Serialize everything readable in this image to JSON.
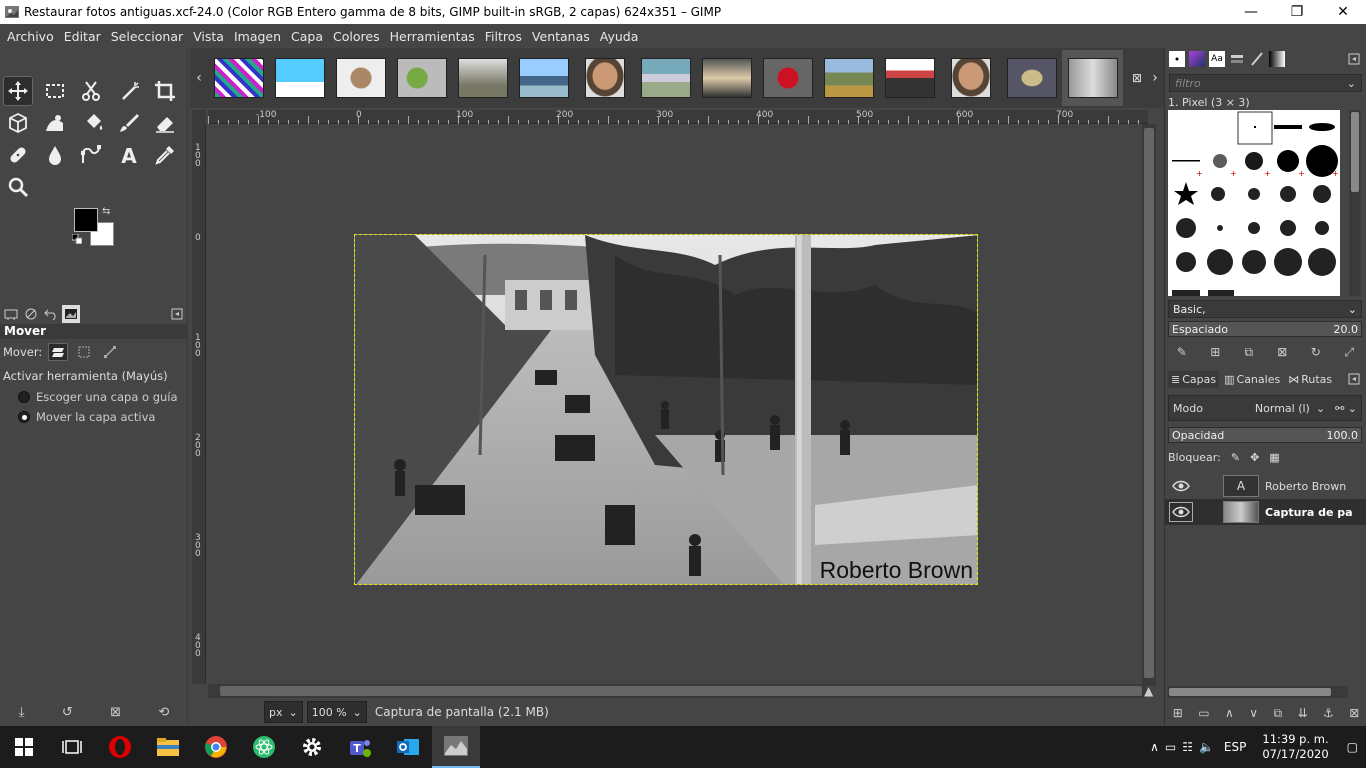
{
  "window": {
    "title": "Restaurar fotos antiguas.xcf-24.0 (Color RGB Entero gamma de 8 bits, GIMP built-in sRGB, 2 capas) 624x351 – GIMP",
    "minimize": "—",
    "maximize": "❐",
    "close": "✕"
  },
  "menu": [
    "Archivo",
    "Editar",
    "Seleccionar",
    "Vista",
    "Imagen",
    "Capa",
    "Colores",
    "Herramientas",
    "Filtros",
    "Ventanas",
    "Ayuda"
  ],
  "tool_options": {
    "title": "Mover",
    "mover_label": "Mover:",
    "activate_label": "Activar herramienta  (Mayús)",
    "option1": "Escoger una capa o guía",
    "option2": "Mover la capa activa",
    "selected_option": 2
  },
  "rulers": {
    "h_labels": [
      "-100",
      "0",
      "100",
      "200",
      "300",
      "400",
      "500",
      "600",
      "700"
    ],
    "v_labels": [
      "100",
      "0",
      "100",
      "200",
      "300",
      "400"
    ]
  },
  "image": {
    "watermark": "Roberto Brown"
  },
  "status": {
    "unit": "px",
    "zoom": "100 %",
    "message": "Captura de pantalla (2.1 MB)"
  },
  "dock": {
    "filter_placeholder": "filtro",
    "brush_name": "1. Pixel (3 × 3)",
    "brush_set": "Basic,",
    "spacing_label": "Espaciado",
    "spacing_value": "20.0",
    "layer_tabs": [
      "Capas",
      "Canales",
      "Rutas"
    ],
    "mode_label": "Modo",
    "mode_value": "Normal (l)",
    "opacity_label": "Opacidad",
    "opacity_value": "100.0",
    "lock_label": "Bloquear:",
    "layers": [
      {
        "name": "Roberto Brown",
        "selected": false
      },
      {
        "name": "Captura de pa",
        "selected": true
      }
    ]
  },
  "taskbar": {
    "language": "ESP",
    "time": "11:39 p. m.",
    "date": "07/17/2020"
  },
  "colors": {
    "accent": "#76b9ed",
    "selection": "#e6e600",
    "fg": "#000000",
    "bg": "#ffffff"
  }
}
